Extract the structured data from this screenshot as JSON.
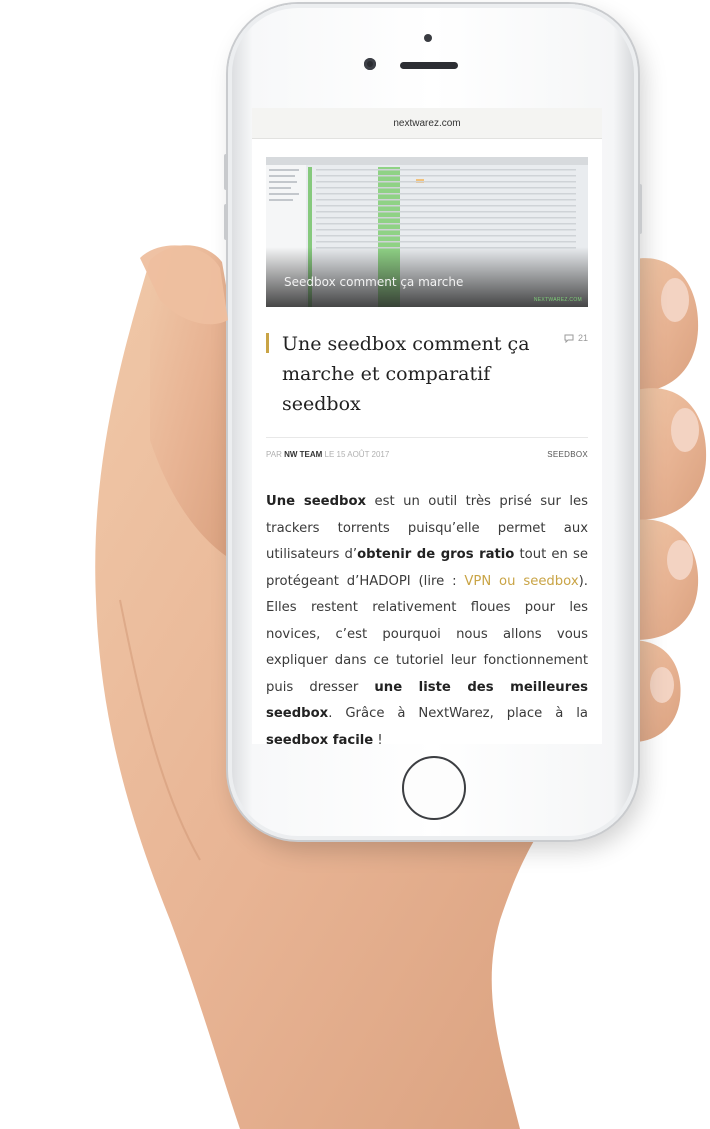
{
  "browser": {
    "url": "nextwarez.com"
  },
  "article": {
    "hero_caption": "Seedbox comment ça marche",
    "hero_watermark": "NEXTWAREZ.COM",
    "title": "Une seedbox comment ça marche et comparatif seedbox",
    "comments": "21",
    "meta": {
      "prefix": "PAR",
      "author": "NW TEAM",
      "date": "LE 15 AOÛT 2017",
      "category": "SEEDBOX"
    },
    "body": {
      "b1": "Une seedbox",
      "t1": " est un outil très prisé sur les trackers torrents puisqu’elle permet aux utilisateurs d’",
      "b2": "obtenir de gros ratio",
      "t2": " tout en se protégeant d’HADOPI (lire : ",
      "link": "VPN ou seedbox",
      "t3": "). Elles restent relativement floues pour les novices, c’est pourquoi nous allons vous expliquer dans ce tutoriel leur fonctionnement puis dresser ",
      "b3": "une liste des meilleures seedbox",
      "t4": ". Grâce à NextWarez, place à la ",
      "b4": "seedbox facile",
      "t5": " !"
    }
  },
  "colors": {
    "accent": "#c9a446",
    "skin": "#e8b898"
  },
  "icons": {
    "comments": "comment-bubble-icon"
  }
}
